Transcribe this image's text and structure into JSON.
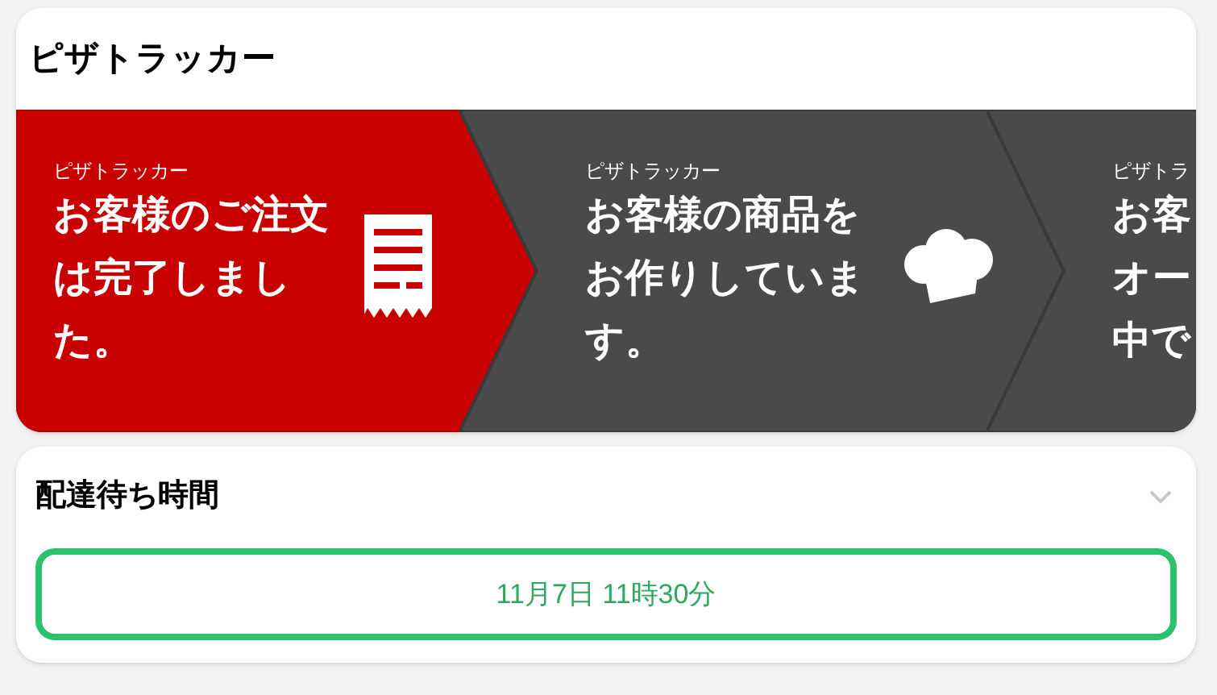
{
  "tracker": {
    "title": "ピザトラッカー",
    "steps": [
      {
        "label": "ピザトラッカー",
        "lines": [
          "お客様のご注文",
          "は完了しまし",
          "た。"
        ],
        "selected": true
      },
      {
        "label": "ピザトラッカー",
        "lines": [
          "お客様の商品を",
          "お作りしていま",
          "す。"
        ],
        "selected": false
      },
      {
        "label": "ピザトラ",
        "lines": [
          "お客",
          "オー",
          "中で"
        ],
        "selected": false
      }
    ]
  },
  "delivery": {
    "title": "配達待ち時間",
    "expanded": false,
    "time": "11月7日 11時30分"
  }
}
